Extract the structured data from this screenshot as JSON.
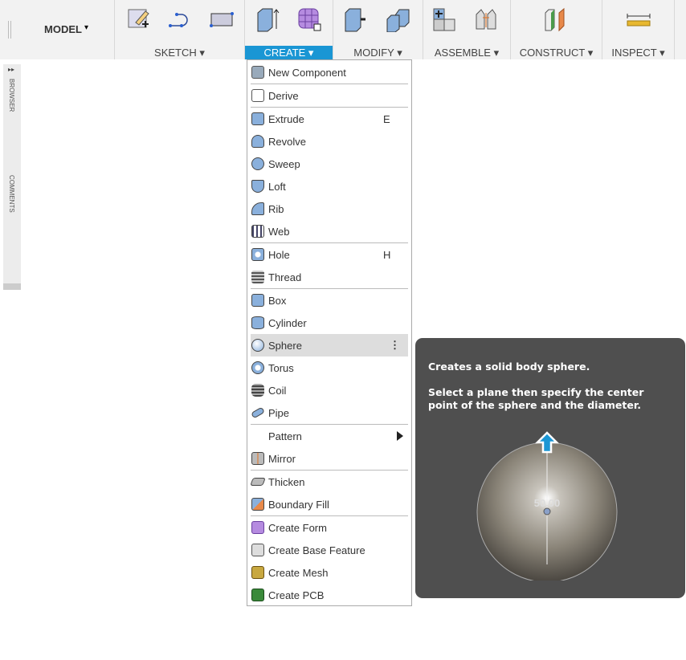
{
  "toolbar": {
    "workspace": "MODEL",
    "groups": [
      {
        "label": "SKETCH"
      },
      {
        "label": "CREATE"
      },
      {
        "label": "MODIFY"
      },
      {
        "label": "ASSEMBLE"
      },
      {
        "label": "CONSTRUCT"
      },
      {
        "label": "INSPECT"
      }
    ],
    "caret": "▾"
  },
  "leftbar": {
    "browser": "BROWSER",
    "comments": "COMMENTS"
  },
  "menu": {
    "items": [
      {
        "label": "New Component"
      },
      {
        "label": "Derive"
      },
      {
        "label": "Extrude",
        "shortcut": "E"
      },
      {
        "label": "Revolve"
      },
      {
        "label": "Sweep"
      },
      {
        "label": "Loft"
      },
      {
        "label": "Rib"
      },
      {
        "label": "Web"
      },
      {
        "label": "Hole",
        "shortcut": "H"
      },
      {
        "label": "Thread"
      },
      {
        "label": "Box"
      },
      {
        "label": "Cylinder"
      },
      {
        "label": "Sphere",
        "more": "⋮"
      },
      {
        "label": "Torus"
      },
      {
        "label": "Coil"
      },
      {
        "label": "Pipe"
      },
      {
        "label": "Pattern"
      },
      {
        "label": "Mirror"
      },
      {
        "label": "Thicken"
      },
      {
        "label": "Boundary Fill"
      },
      {
        "label": "Create Form"
      },
      {
        "label": "Create Base Feature"
      },
      {
        "label": "Create Mesh"
      },
      {
        "label": "Create PCB"
      }
    ]
  },
  "tooltip": {
    "line1": "Creates a solid body sphere.",
    "line2": "Select a plane then specify the center point of the sphere and the diameter.",
    "dimension": "50.00"
  },
  "colors": {
    "accent": "#1a96d4",
    "tooltip_bg": "#4f4f4f"
  }
}
